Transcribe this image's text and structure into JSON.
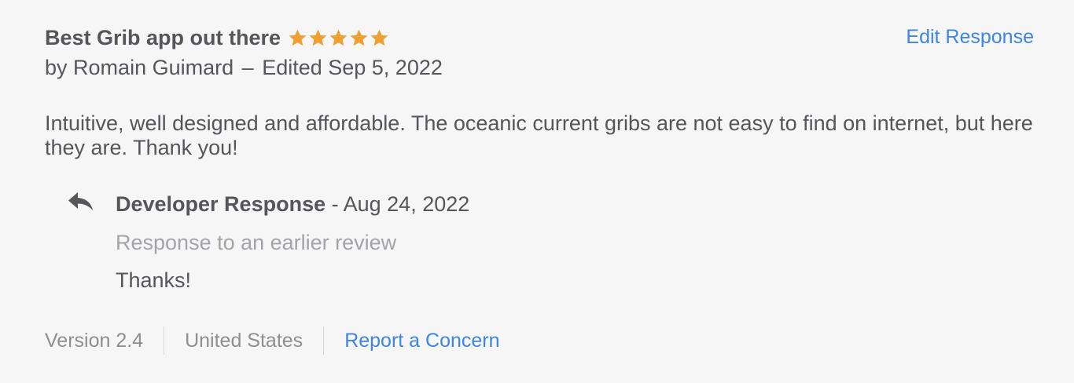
{
  "review": {
    "title": "Best Grib app out there",
    "rating": 5,
    "star_color": "#f0a030",
    "author_prefix": "by",
    "author": "Romain Guimard",
    "separator": "–",
    "edited_label": "Edited Sep 5, 2022",
    "body": "Intuitive, well designed and affordable. The oceanic current gribs are not easy to find on internet, but here they are. Thank you!"
  },
  "actions": {
    "edit_response": "Edit Response",
    "report_concern": "Report a Concern"
  },
  "developer_response": {
    "icon": "reply-arrow-icon",
    "title": "Developer Response",
    "date": " - Aug 24, 2022",
    "subtitle": "Response to an earlier review",
    "text": "Thanks!"
  },
  "footer": {
    "version": "Version 2.4",
    "country": "United States"
  },
  "colors": {
    "link": "#3d86e0",
    "text": "#55555a",
    "muted": "#a3a3a8"
  }
}
